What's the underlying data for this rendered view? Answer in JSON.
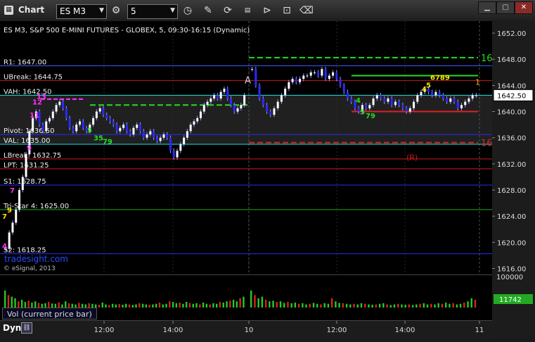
{
  "window": {
    "title": "Chart",
    "symbol": "ES M3",
    "interval": "5",
    "toolbar_icons": [
      "settings-gear-icon",
      "refresh-clock-icon",
      "draw-pencil-icon",
      "swap-icon",
      "study-icon",
      "play-icon",
      "stop-icon",
      "eraser-icon"
    ]
  },
  "chart_data": {
    "type": "line",
    "title": "ES M3, S&P 500 E-MINI FUTURES - GLOBEX, 5, 09:30-16:15 (Dynamic)",
    "watermark": "tradesight.com",
    "copyright": "© eSignal, 2013",
    "price_axis": {
      "ticks": [
        1616.0,
        1620.0,
        1624.0,
        1628.0,
        1632.0,
        1636.0,
        1640.0,
        1644.0,
        1648.0,
        1652.0
      ],
      "tick_labels": [
        "1616.00",
        "1620.00",
        "1624.00",
        "1628.00",
        "1632.00",
        "1636.00",
        "1640.00",
        "1644.00",
        "1648.00",
        "1652.00"
      ],
      "last_price": "1642.50",
      "volume_top": "100000",
      "volume_last": "11742",
      "ylim": [
        1615.3,
        1653.3
      ]
    },
    "time_axis": {
      "labels": [
        "12:00",
        "14:00",
        "10",
        "12:00",
        "14:00",
        "11"
      ]
    },
    "levels": [
      {
        "label": "R1: 1647.00",
        "value": 1647.0,
        "color": "#3a5aff",
        "style": "solid",
        "side": "left"
      },
      {
        "label": "UBreak: 1644.75",
        "value": 1644.75,
        "color": "#cc1a1a",
        "style": "solid",
        "side": "left"
      },
      {
        "label": "VAH: 1642.50",
        "value": 1642.5,
        "color": "#1ee0e0",
        "style": "solid",
        "side": "left"
      },
      {
        "label": "Pivot: 1636.50",
        "value": 1636.5,
        "color": "#2a2aff",
        "style": "solid",
        "side": "left"
      },
      {
        "label": "VAL: 1635.00",
        "value": 1635.0,
        "color": "#1ee0e0",
        "style": "solid",
        "side": "left"
      },
      {
        "label": "LBreak: 1632.75",
        "value": 1632.75,
        "color": "#cc1a1a",
        "style": "solid",
        "side": "left"
      },
      {
        "label": "LPT: 1631.25",
        "value": 1631.25,
        "color": "#cc1a1a",
        "style": "solid",
        "side": "left"
      },
      {
        "label": "S1: 1628.75",
        "value": 1628.75,
        "color": "#2a2aff",
        "style": "solid",
        "side": "left"
      },
      {
        "label": "Tri-Star 4: 1625.00",
        "value": 1625.0,
        "color": "#22aa22",
        "style": "solid",
        "side": "left"
      },
      {
        "label": "S2: 1618.25",
        "value": 1618.25,
        "color": "#2a2aff",
        "style": "solid",
        "side": "left"
      }
    ],
    "day2_levels": [
      {
        "value": 1648.25,
        "color": "#22dd22",
        "style": "dashed",
        "label": "16"
      },
      {
        "value": 1645.5,
        "color": "#22dd22",
        "style": "solid",
        "label": ""
      },
      {
        "value": 1640.0,
        "color": "#dd2222",
        "style": "solid",
        "label": ""
      },
      {
        "value": 1635.25,
        "color": "#dd2222",
        "style": "dashed",
        "label": "16"
      }
    ],
    "annotations": [
      {
        "text": "A",
        "value": 1644.75,
        "color": "#cfcfcf"
      },
      {
        "text": "(R)",
        "value": 1633.0,
        "color": "#cc1a1a"
      },
      {
        "text": "1",
        "value": 1644.5,
        "color": "#ffb000"
      }
    ],
    "setup_counts": [
      {
        "text": "13",
        "value": 1642.4,
        "color": "#ff33ff"
      },
      {
        "text": "12",
        "value": 1641.5,
        "color": "#ff33ff"
      },
      {
        "text": "11",
        "value": 1639.5,
        "color": "#ff33ff"
      },
      {
        "text": "9",
        "value": 1634.5,
        "color": "#ff33ff"
      },
      {
        "text": "7",
        "value": 1628.0,
        "color": "#ff33ff"
      },
      {
        "text": "4",
        "value": 1619.5,
        "color": "#ff33ff"
      },
      {
        "text": "9",
        "value": 1625.0,
        "color": "#ffe000"
      },
      {
        "text": "7",
        "value": 1624.0,
        "color": "#ffe000"
      },
      {
        "text": "6789",
        "value": 1645.3,
        "color": "#ffe000"
      },
      {
        "text": "5",
        "value": 1644.1,
        "color": "#ffe000"
      },
      {
        "text": "4",
        "value": 1643.5,
        "color": "#ffe000"
      },
      {
        "text": "79",
        "value": 1639.4,
        "color": "#22dd22"
      },
      {
        "text": "5",
        "value": 1640.0,
        "color": "#22dd22"
      },
      {
        "text": "4",
        "value": 1641.8,
        "color": "#22dd22"
      },
      {
        "text": "5",
        "value": 1637.2,
        "color": "#22dd22"
      },
      {
        "text": "35",
        "value": 1636.0,
        "color": "#22dd22"
      },
      {
        "text": "79",
        "value": 1635.5,
        "color": "#22dd22"
      }
    ],
    "series": [
      {
        "name": "ES M3 price",
        "color": "#2a2aff",
        "day1_closes": [
          1619.0,
          1621.5,
          1623.0,
          1625.0,
          1628.0,
          1630.0,
          1633.5,
          1637.0,
          1639.0,
          1640.0,
          1638.0,
          1637.0,
          1638.5,
          1639.0,
          1640.0,
          1641.0,
          1641.5,
          1640.5,
          1639.0,
          1637.5,
          1637.0,
          1638.0,
          1638.5,
          1637.5,
          1637.0,
          1638.0,
          1639.0,
          1640.0,
          1640.5,
          1639.5,
          1639.0,
          1638.5,
          1638.0,
          1637.0,
          1637.5,
          1638.0,
          1637.0,
          1636.5,
          1637.5,
          1638.0,
          1637.0,
          1636.0,
          1636.5,
          1637.0,
          1636.0,
          1635.5,
          1636.0,
          1636.5,
          1636.0,
          1634.0,
          1633.0,
          1634.0,
          1635.0,
          1636.0,
          1637.0,
          1638.0,
          1638.5,
          1639.0,
          1640.0,
          1641.0,
          1641.5,
          1642.0,
          1642.5,
          1642.0,
          1643.0,
          1643.5,
          1642.0,
          1641.0,
          1640.0,
          1640.5,
          1641.0,
          1642.5
        ],
        "day2_closes": [
          1646.5,
          1644.0,
          1642.0,
          1641.0,
          1640.0,
          1639.5,
          1640.5,
          1641.5,
          1642.5,
          1643.5,
          1644.5,
          1645.0,
          1644.5,
          1645.0,
          1645.5,
          1645.5,
          1646.0,
          1646.0,
          1645.5,
          1646.5,
          1645.0,
          1645.5,
          1646.0,
          1645.0,
          1644.0,
          1643.0,
          1642.0,
          1641.5,
          1640.5,
          1640.0,
          1641.0,
          1640.5,
          1641.0,
          1642.0,
          1642.5,
          1642.0,
          1641.5,
          1642.0,
          1641.0,
          1641.5,
          1641.0,
          1640.5,
          1640.0,
          1640.5,
          1641.5,
          1642.5,
          1643.0,
          1643.5,
          1643.0,
          1642.5,
          1643.0,
          1642.5,
          1642.0,
          1641.5,
          1642.0,
          1641.5,
          1640.5,
          1641.0,
          1641.5,
          1642.0,
          1642.5,
          1642.5
        ]
      }
    ],
    "volume_ratio": [
      0.55,
      0.4,
      0.35,
      0.3,
      0.2,
      0.25,
      0.18,
      0.22,
      0.16,
      0.2,
      0.15,
      0.12,
      0.14,
      0.18,
      0.13,
      0.12,
      0.16,
      0.1,
      0.2,
      0.14,
      0.12,
      0.1,
      0.15,
      0.12,
      0.1,
      0.14,
      0.12,
      0.1,
      0.09,
      0.16,
      0.1,
      0.08,
      0.12,
      0.1,
      0.11,
      0.09,
      0.12,
      0.1,
      0.08,
      0.1,
      0.14,
      0.12,
      0.1,
      0.09,
      0.1,
      0.12,
      0.16,
      0.1,
      0.12,
      0.2,
      0.18,
      0.14,
      0.16,
      0.12,
      0.18,
      0.15,
      0.12,
      0.14,
      0.1,
      0.16,
      0.12,
      0.1,
      0.14,
      0.12,
      0.18,
      0.16,
      0.2,
      0.22,
      0.25,
      0.2,
      0.3,
      0.35,
      0.55,
      0.4,
      0.3,
      0.35,
      0.25,
      0.2,
      0.22,
      0.18,
      0.2,
      0.15,
      0.18,
      0.14,
      0.16,
      0.12,
      0.14,
      0.1,
      0.12,
      0.15,
      0.12,
      0.1,
      0.14,
      0.12,
      0.3,
      0.2,
      0.15,
      0.14,
      0.12,
      0.1,
      0.12,
      0.1,
      0.14,
      0.12,
      0.1,
      0.09,
      0.1,
      0.12,
      0.14,
      0.1,
      0.08,
      0.1,
      0.12,
      0.1,
      0.09,
      0.1,
      0.08,
      0.1,
      0.12,
      0.14,
      0.1,
      0.12,
      0.1,
      0.14,
      0.12,
      0.16,
      0.12,
      0.14,
      0.1,
      0.12,
      0.16,
      0.2,
      0.3,
      0.25
    ],
    "volume_legend": "Vol (current price bar)",
    "footer_label": "Dyn"
  }
}
